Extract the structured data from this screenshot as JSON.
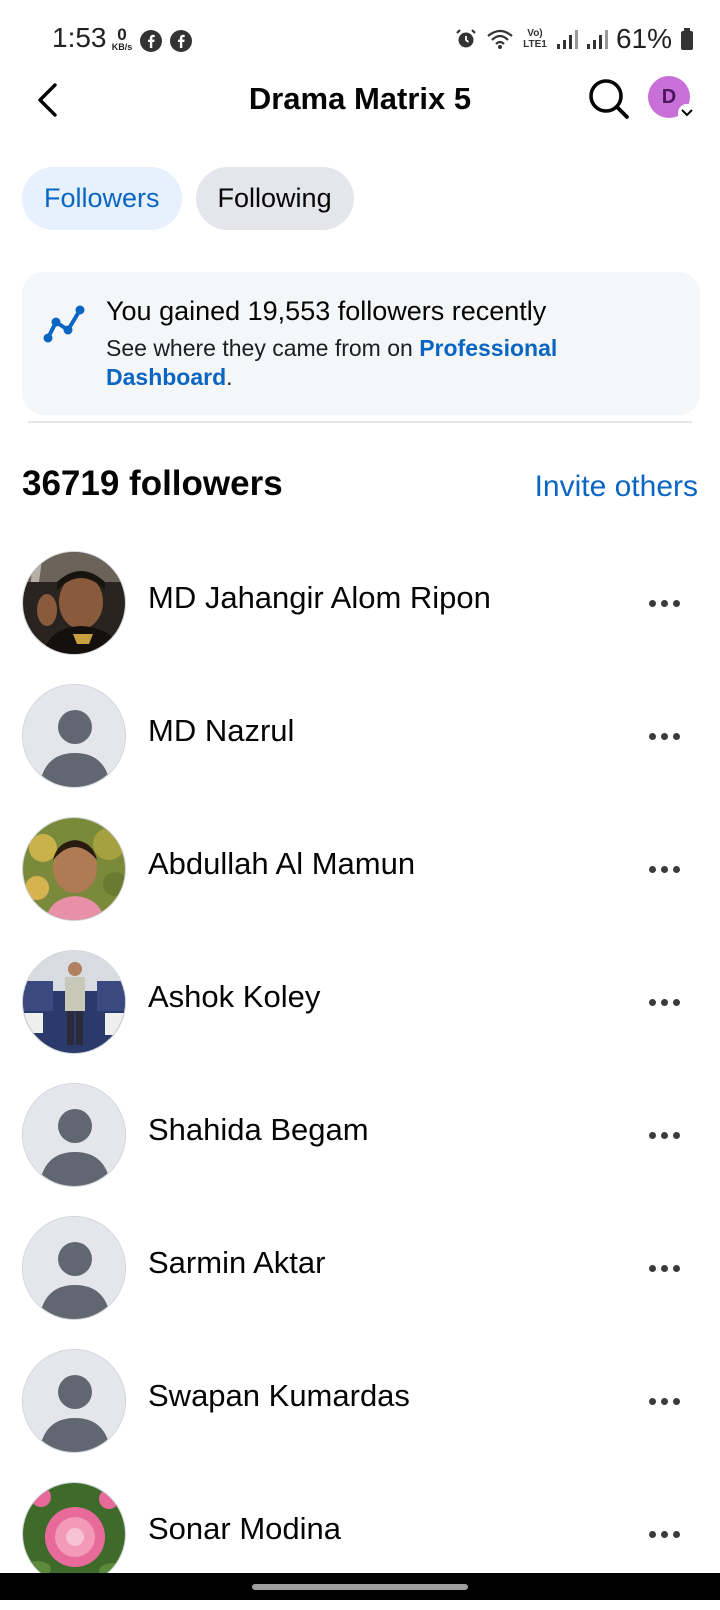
{
  "status_bar": {
    "time": "1:53",
    "data_rate_value": "0",
    "data_rate_unit": "KB/s",
    "network_label": "Vo) LTE1",
    "battery": "61%"
  },
  "header": {
    "title": "Drama Matrix 5",
    "avatar_initial": "D"
  },
  "tabs": [
    {
      "label": "Followers",
      "active": true
    },
    {
      "label": "Following",
      "active": false
    }
  ],
  "banner": {
    "title": "You gained 19,553 followers recently",
    "body_prefix": "See where they came from on ",
    "link": "Professional Dashboard",
    "body_suffix": "."
  },
  "followers_section": {
    "count_label": "36719 followers",
    "invite_label": "Invite others"
  },
  "followers": [
    {
      "name": "MD Jahangir Alom Ripon",
      "avatar": "photo-man-dark"
    },
    {
      "name": "MD Nazrul",
      "avatar": "default"
    },
    {
      "name": "Abdullah Al Mamun",
      "avatar": "photo-child"
    },
    {
      "name": "Ashok Koley",
      "avatar": "photo-man-interior"
    },
    {
      "name": "Shahida Begam",
      "avatar": "default"
    },
    {
      "name": "Sarmin Aktar",
      "avatar": "default"
    },
    {
      "name": "Swapan Kumardas",
      "avatar": "default"
    },
    {
      "name": "Sonar Modina",
      "avatar": "photo-flower"
    }
  ],
  "colors": {
    "accent_blue": "#0a66c2",
    "active_tab_bg": "#e7f0fd",
    "inactive_tab_bg": "#e4e6eb",
    "banner_bg": "#f4f6f8",
    "avatar_purple": "#c86fd8"
  }
}
